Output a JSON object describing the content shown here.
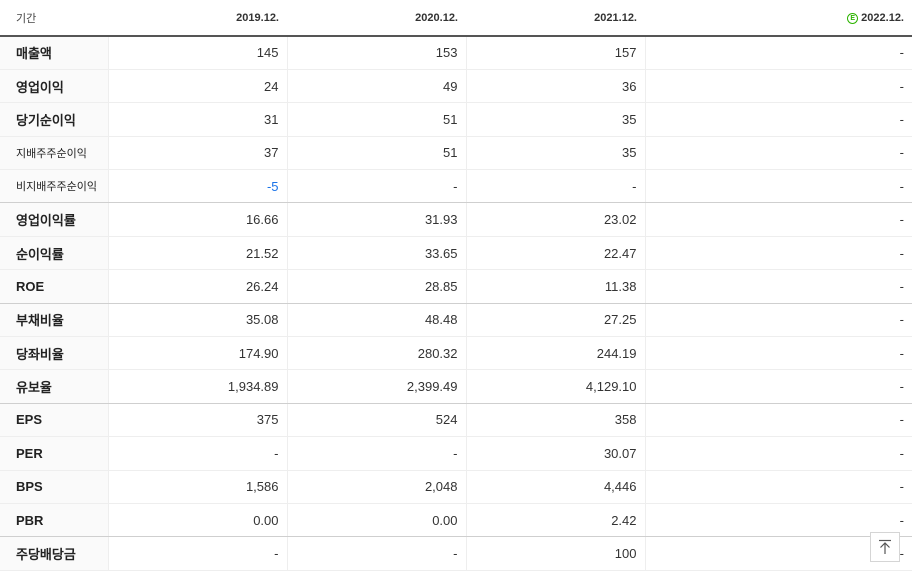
{
  "header": {
    "label": "기간",
    "periods": [
      "2019.12.",
      "2020.12.",
      "2021.12.",
      "2022.12."
    ],
    "estimate_marker": "E"
  },
  "rows": [
    {
      "label": "매출액",
      "values": [
        "145",
        "153",
        "157",
        "-"
      ]
    },
    {
      "label": "영업이익",
      "values": [
        "24",
        "49",
        "36",
        "-"
      ]
    },
    {
      "label": "당기순이익",
      "values": [
        "31",
        "51",
        "35",
        "-"
      ]
    },
    {
      "label": "지배주주순이익",
      "values": [
        "37",
        "51",
        "35",
        "-"
      ]
    },
    {
      "label": "비지배주주순이익",
      "values": [
        "-5",
        "-",
        "-",
        "-"
      ]
    },
    {
      "label": "영업이익률",
      "values": [
        "16.66",
        "31.93",
        "23.02",
        "-"
      ]
    },
    {
      "label": "순이익률",
      "values": [
        "21.52",
        "33.65",
        "22.47",
        "-"
      ]
    },
    {
      "label": "ROE",
      "values": [
        "26.24",
        "28.85",
        "11.38",
        "-"
      ]
    },
    {
      "label": "부채비율",
      "values": [
        "35.08",
        "48.48",
        "27.25",
        "-"
      ]
    },
    {
      "label": "당좌비율",
      "values": [
        "174.90",
        "280.32",
        "244.19",
        "-"
      ]
    },
    {
      "label": "유보율",
      "values": [
        "1,934.89",
        "2,399.49",
        "4,129.10",
        "-"
      ]
    },
    {
      "label": "EPS",
      "values": [
        "375",
        "524",
        "358",
        "-"
      ]
    },
    {
      "label": "PER",
      "values": [
        "-",
        "-",
        "30.07",
        "-"
      ]
    },
    {
      "label": "BPS",
      "values": [
        "1,586",
        "2,048",
        "4,446",
        "-"
      ]
    },
    {
      "label": "PBR",
      "values": [
        "0.00",
        "0.00",
        "2.42",
        "-"
      ]
    },
    {
      "label": "주당배당금",
      "values": [
        "-",
        "-",
        "100",
        "-"
      ]
    }
  ],
  "colors": {
    "negative": "#1a73e8",
    "estimate": "#2db400"
  },
  "icons": {
    "scroll_top": "arrow-up-to-line-icon"
  }
}
